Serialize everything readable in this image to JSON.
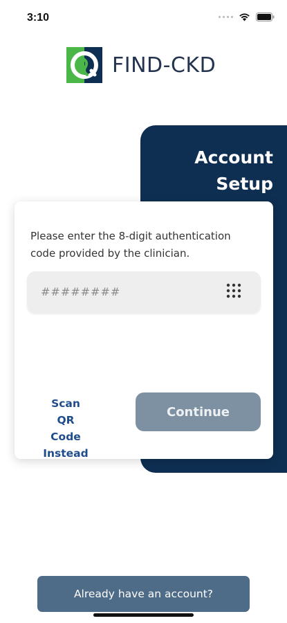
{
  "status_bar": {
    "time": "3:10",
    "icons": [
      "cellular-signal-icon",
      "wifi-icon",
      "battery-icon"
    ]
  },
  "brand": {
    "name": "FIND-CKD",
    "logo_icon": "find-ckd-logo-icon",
    "colors": {
      "navy": "#0e2f52",
      "green": "#4bb748",
      "text": "#24344f"
    }
  },
  "setup_panel": {
    "title_line1": "Account",
    "title_line2": "Setup",
    "color": "#0e2f52"
  },
  "card": {
    "instruction": "Please enter the 8-digit authentication code provided by the clinician.",
    "code_field": {
      "value": "",
      "placeholder": "########",
      "icon": "keypad-icon"
    },
    "scan_qr_label": "Scan QR Code Instead",
    "continue_label": "Continue",
    "continue_color": "#7d91a2"
  },
  "footer": {
    "account_button_label": "Already have an account?",
    "account_button_color": "#4e6b87"
  }
}
